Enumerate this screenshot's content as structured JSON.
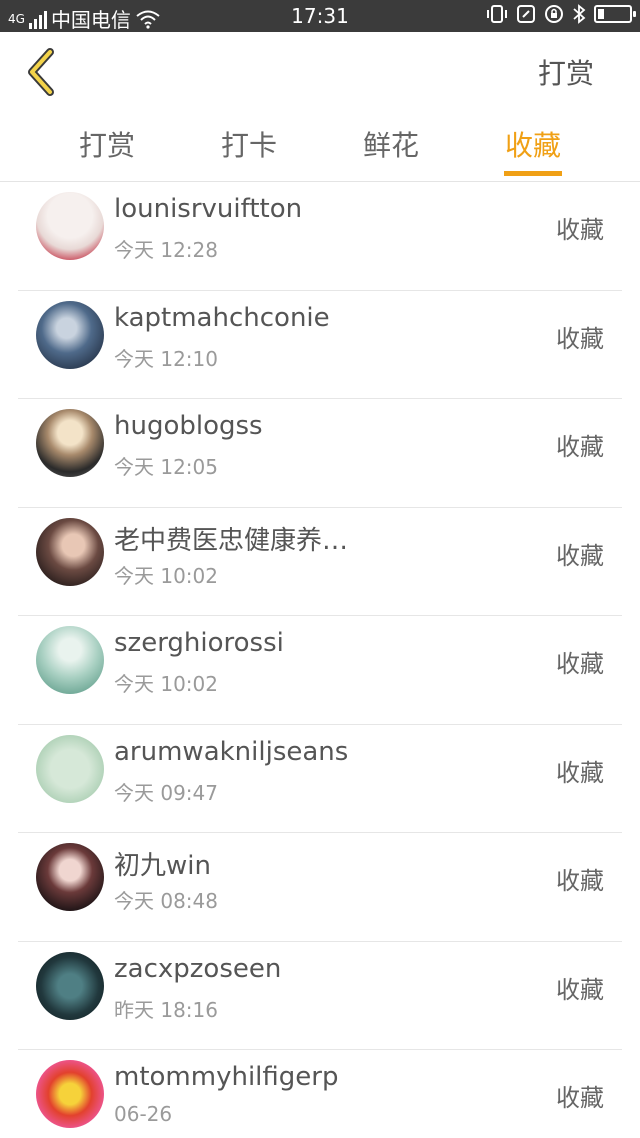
{
  "status_bar": {
    "network": "4G",
    "carrier": "中国电信",
    "time": "17:31",
    "icons": [
      "signal-icon",
      "wifi-icon",
      "vibrate-icon",
      "nfc-icon",
      "lock-icon",
      "bluetooth-icon",
      "battery-icon"
    ]
  },
  "header": {
    "back_icon": "chevron-left-icon",
    "action_label": "打赏"
  },
  "colors": {
    "accent": "#f0a015",
    "text": "#555555",
    "subtext": "#9a9a9a",
    "status_bar_bg": "#3b3b3b"
  },
  "tabs": [
    {
      "label": "打赏",
      "active": false
    },
    {
      "label": "打卡",
      "active": false
    },
    {
      "label": "鲜花",
      "active": false
    },
    {
      "label": "收藏",
      "active": true
    }
  ],
  "list": [
    {
      "name": "lounisrvuiftton",
      "time": "今天 12:28",
      "action": "收藏"
    },
    {
      "name": "kaptmahchconie",
      "time": "今天 12:10",
      "action": "收藏"
    },
    {
      "name": "hugoblogss",
      "time": "今天 12:05",
      "action": "收藏"
    },
    {
      "name": "老中费医忠健康养…",
      "time": "今天 10:02",
      "action": "收藏"
    },
    {
      "name": "szerghiorossi",
      "time": "今天 10:02",
      "action": "收藏"
    },
    {
      "name": "arumwakniljseans",
      "time": "今天 09:47",
      "action": "收藏"
    },
    {
      "name": "初九win",
      "time": "今天 08:48",
      "action": "收藏"
    },
    {
      "name": "zacxpzoseen",
      "time": "昨天 18:16",
      "action": "收藏"
    },
    {
      "name": "mtommyhilfigerp",
      "time": "06-26",
      "action": "收藏"
    }
  ]
}
